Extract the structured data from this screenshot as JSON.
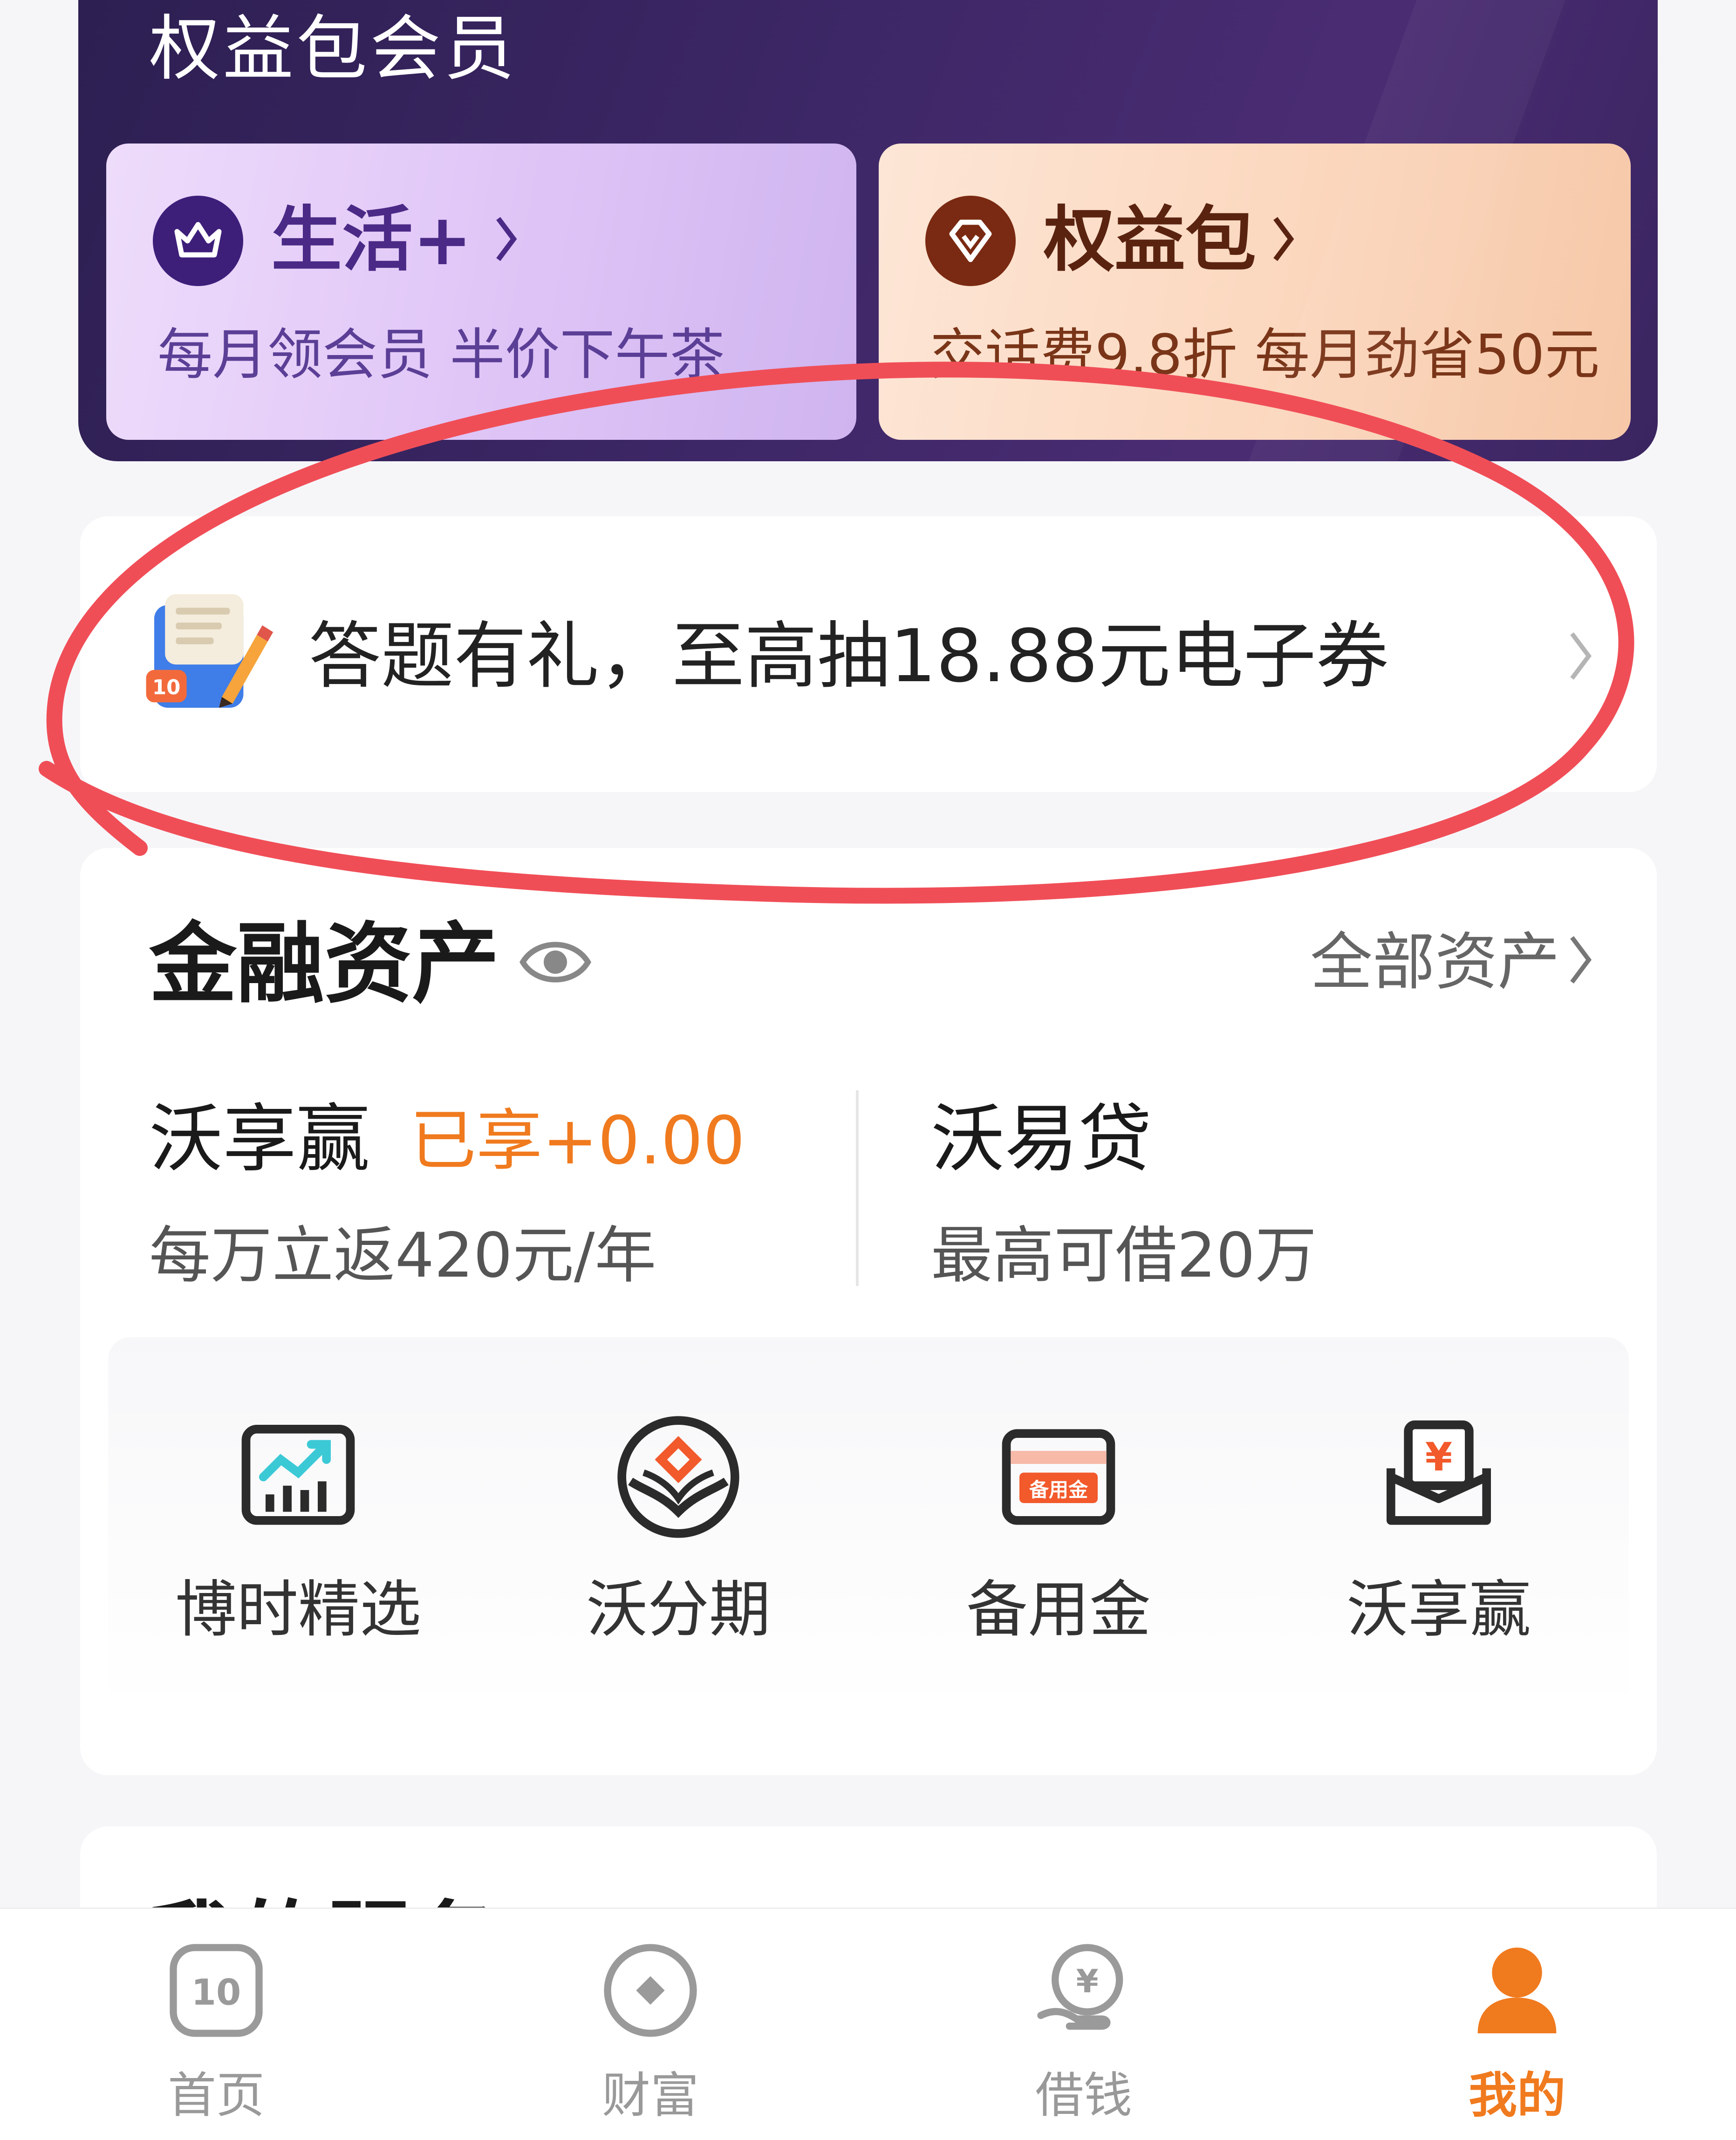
{
  "header": {
    "title": "权益包会员",
    "cards": [
      {
        "title": "生活+",
        "subtitle": "每月领会员 半价下午茶"
      },
      {
        "title": "权益包",
        "subtitle": "交话费9.8折 每月劲省50元"
      }
    ]
  },
  "quiz_banner": {
    "text": "答题有礼，至高抽18.88元电子券",
    "badge": "10"
  },
  "finance": {
    "title": "金融资产",
    "all_assets": "全部资产",
    "products": [
      {
        "name": "沃享赢",
        "tag": "已享+0.00",
        "desc": "每万立返420元/年"
      },
      {
        "name": "沃易贷",
        "desc": "最高可借20万"
      }
    ],
    "quick_links": [
      {
        "label": "博时精选",
        "icon": "chart-board-icon"
      },
      {
        "label": "沃分期",
        "icon": "lotus-diamond-icon"
      },
      {
        "label": "备用金",
        "icon": "card-icon",
        "icon_text": "备用金"
      },
      {
        "label": "沃享赢",
        "icon": "yuan-envelope-icon",
        "icon_text": "¥"
      }
    ]
  },
  "services": {
    "title": "我的服务"
  },
  "tabbar": {
    "items": [
      {
        "label": "首页",
        "icon": "home-10-icon",
        "active": false
      },
      {
        "label": "财富",
        "icon": "wealth-icon",
        "active": false
      },
      {
        "label": "借钱",
        "icon": "borrow-yuan-icon",
        "icon_text": "¥",
        "active": false
      },
      {
        "label": "我的",
        "icon": "user-icon",
        "active": true
      }
    ]
  },
  "colors": {
    "accent_orange": "#f07a1e",
    "header_purple": "#3d2766",
    "annotation_red": "#f04e57"
  }
}
